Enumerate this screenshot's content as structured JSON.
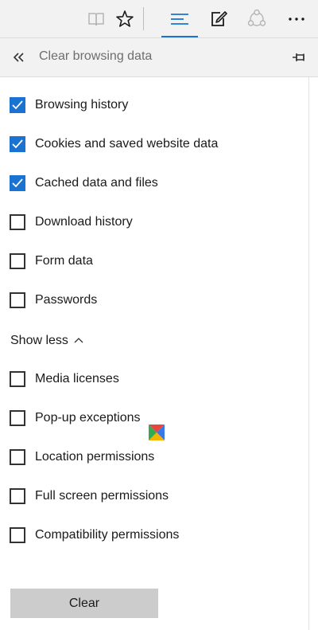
{
  "toolbar": {
    "items": [
      {
        "name": "reading-view-icon",
        "state": "disabled"
      },
      {
        "name": "favorites-star-icon",
        "state": "normal"
      },
      {
        "name": "hub-icon",
        "state": "active"
      },
      {
        "name": "web-note-icon",
        "state": "normal"
      },
      {
        "name": "share-icon",
        "state": "disabled"
      },
      {
        "name": "more-icon",
        "state": "normal"
      }
    ],
    "accent_color": "#1a73d0"
  },
  "panel": {
    "title": "Clear browsing data",
    "back_icon": "double-chevron-left-icon",
    "pin_icon": "pin-icon"
  },
  "options": {
    "browsing_history": {
      "label": "Browsing history",
      "checked": true
    },
    "cookies": {
      "label": "Cookies and saved website data",
      "checked": true
    },
    "cached": {
      "label": "Cached data and files",
      "checked": true
    },
    "download_history": {
      "label": "Download history",
      "checked": false
    },
    "form_data": {
      "label": "Form data",
      "checked": false
    },
    "passwords": {
      "label": "Passwords",
      "checked": false
    },
    "media_licenses": {
      "label": "Media licenses",
      "checked": false
    },
    "popup_exceptions": {
      "label": "Pop-up exceptions",
      "checked": false
    },
    "location_permissions": {
      "label": "Location permissions",
      "checked": false
    },
    "fullscreen_permissions": {
      "label": "Full screen permissions",
      "checked": false
    },
    "compat_permissions": {
      "label": "Compatibility permissions",
      "checked": false
    }
  },
  "show_less": {
    "label": "Show less"
  },
  "clear_button": {
    "label": "Clear"
  },
  "colors": {
    "checkbox_checked": "#1a73d0",
    "toolbar_bg": "#f2f2f2",
    "button_bg": "#cccccc"
  }
}
